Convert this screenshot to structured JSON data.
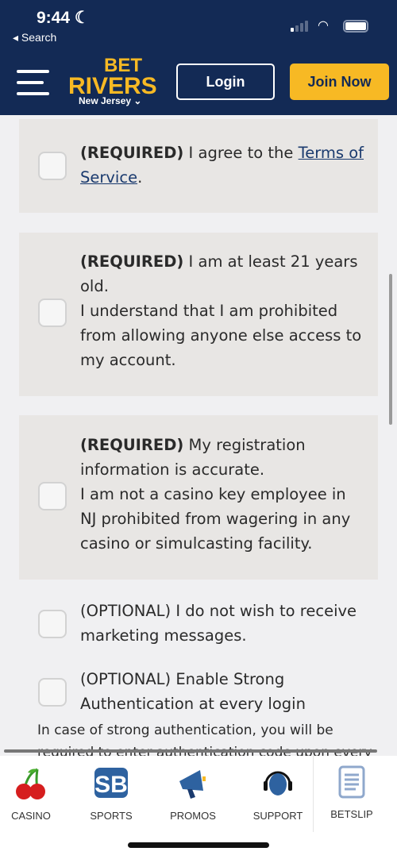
{
  "status": {
    "time": "9:44",
    "moon": "☾",
    "back": "◂ Search"
  },
  "header": {
    "logo": "BET RIVERS",
    "logo_top": "BET",
    "logo_bottom": "RIVERS",
    "region": "New Jersey ⌄",
    "login": "Login",
    "join": "Join Now"
  },
  "colors": {
    "navy": "#132a55",
    "accent": "#f7b924",
    "card": "#e8e6e4"
  },
  "consents": [
    {
      "tag": "(REQUIRED)",
      "text": " I agree to the ",
      "link": "Terms of Service",
      "end": "."
    },
    {
      "tag": "(REQUIRED)",
      "text": " I am at least 21 years old.",
      "text2": "I understand that I am prohibited from allowing anyone else access to my account."
    },
    {
      "tag": "(REQUIRED)",
      "text": " My registration information is accurate.",
      "text2": "I am not a casino key employee in NJ prohibited from wagering in any casino or simulcasting facility."
    },
    {
      "text": "(OPTIONAL) I do not wish to receive marketing messages."
    },
    {
      "text": "(OPTIONAL) Enable Strong Authentication at every login"
    }
  ],
  "note": "In case of strong authentication, you will be required to enter authentication code upon every",
  "tabs": [
    {
      "label": "CASINO",
      "icon": "cherries-icon"
    },
    {
      "label": "SPORTS",
      "icon": "sb-icon"
    },
    {
      "label": "PROMOS",
      "icon": "megaphone-icon"
    },
    {
      "label": "SUPPORT",
      "icon": "headset-icon"
    },
    {
      "label": "BETSLIP",
      "icon": "receipt-icon"
    }
  ]
}
